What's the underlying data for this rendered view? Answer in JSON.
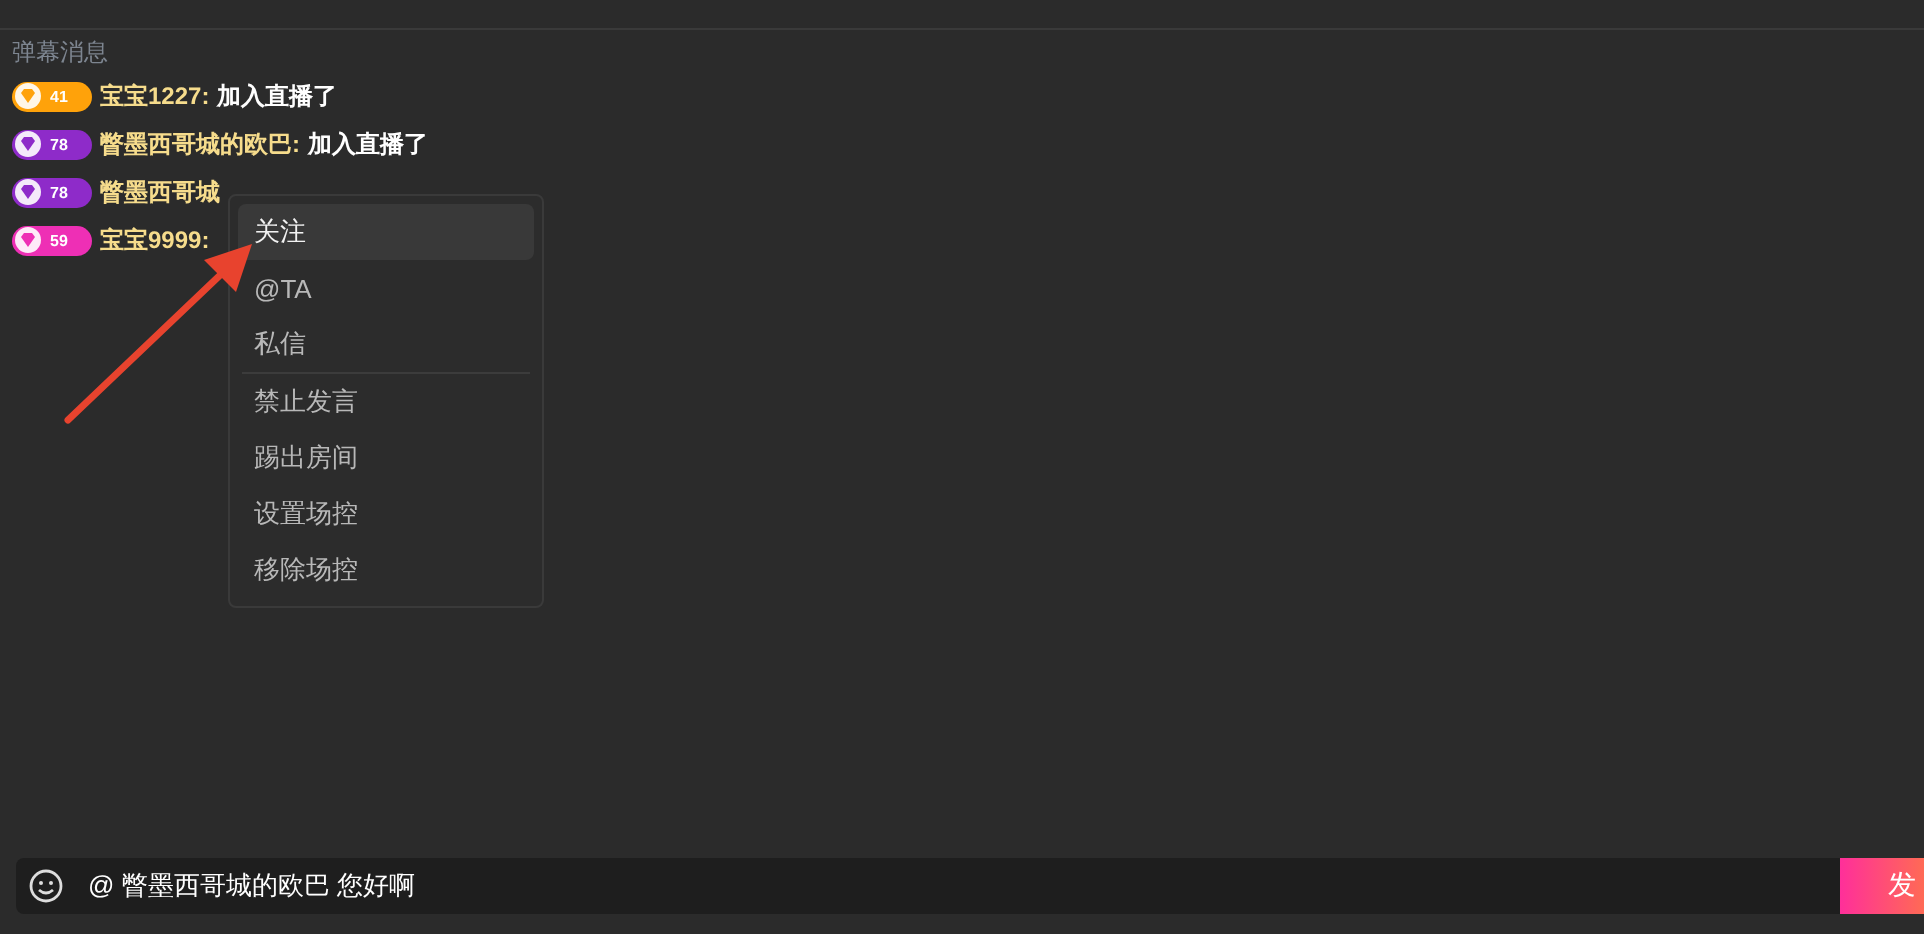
{
  "section_title": "弹幕消息",
  "messages": [
    {
      "badge": {
        "level": "41",
        "color": "#ffa20a"
      },
      "name": "宝宝1227:",
      "text": "加入直播了"
    },
    {
      "badge": {
        "level": "78",
        "color": "#8e2bc9"
      },
      "name": "瞥墨西哥城的欧巴:",
      "text": "加入直播了"
    },
    {
      "badge": {
        "level": "78",
        "color": "#8e2bc9"
      },
      "name": "瞥墨西哥城"
    },
    {
      "badge": {
        "level": "59",
        "color": "#ee2fb5"
      },
      "name": "宝宝9999:"
    }
  ],
  "context_menu": {
    "groups": [
      [
        {
          "label": "关注",
          "selected": true
        },
        {
          "label": "@TA",
          "selected": false
        },
        {
          "label": "私信",
          "selected": false
        }
      ],
      [
        {
          "label": "禁止发言",
          "selected": false
        },
        {
          "label": "踢出房间",
          "selected": false
        },
        {
          "label": "设置场控",
          "selected": false
        },
        {
          "label": "移除场控",
          "selected": false
        }
      ]
    ]
  },
  "composer": {
    "value": "@ 瞥墨西哥城的欧巴 您好啊",
    "send_label": "发"
  }
}
